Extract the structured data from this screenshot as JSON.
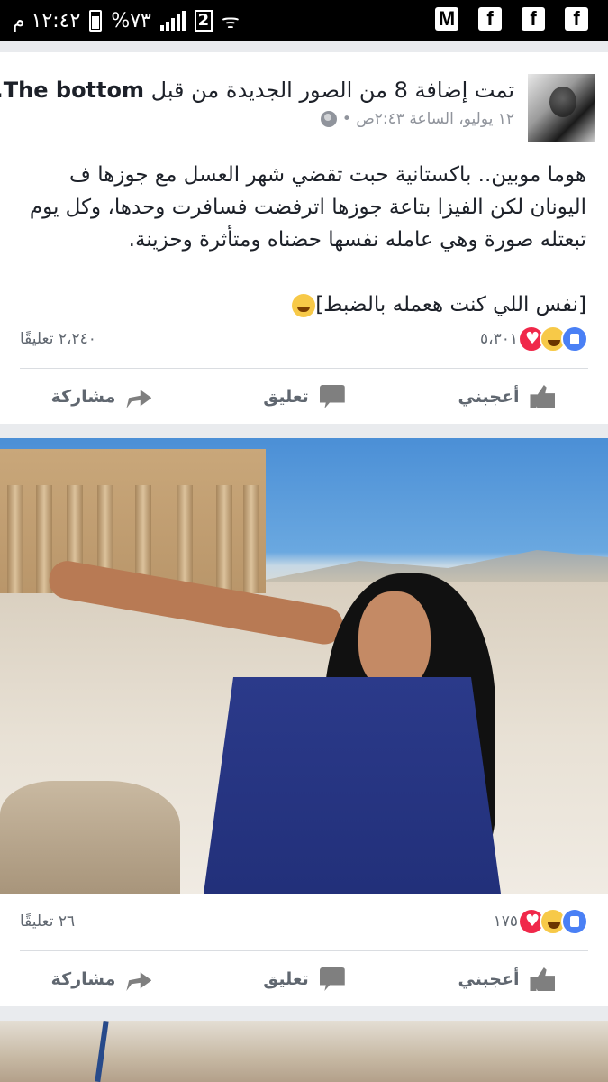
{
  "statusbar": {
    "time": "١٢:٤٢ م",
    "battery": "%٧٣",
    "sim_badge": "2",
    "notification_icons": [
      "gmail-icon",
      "facebook-icon",
      "facebook-icon",
      "facebook-icon"
    ]
  },
  "post1": {
    "page_name": "The bottom.",
    "action_text": "تمت إضافة 8 من الصور الجديدة من قبل",
    "timestamp": "١٢ يوليو، الساعة ٢:٤٣ص •",
    "text_para1": "هوما موبين.. باكستانية حبت تقضي شهر العسل مع جوزها ف اليونان لكن الفيزا بتاعة جوزها اترفضت فسافرت وحدها، وكل يوم تبعتله صورة وهي عامله نفسها حضناه ومتأثرة وحزينة.",
    "text_para2": "[نفس اللي كنت هعمله بالضبط]",
    "reactions_count": "٥،٣٠١",
    "comments_count": "٢،٢٤٠ تعليقًا",
    "like_label": "أعجبني",
    "comment_label": "تعليق",
    "share_label": "مشاركة"
  },
  "post2": {
    "reactions_count": "١٧٥",
    "comments_count": "٢٦ تعليقًا",
    "like_label": "أعجبني",
    "comment_label": "تعليق",
    "share_label": "مشاركة"
  },
  "colors": {
    "like_blue": "#4a80f5",
    "haha_yellow": "#f7c948",
    "love_red": "#f0284a",
    "text_dark": "#1d2129",
    "meta_gray": "#90949c"
  }
}
